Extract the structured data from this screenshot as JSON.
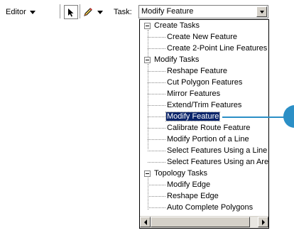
{
  "toolbar": {
    "editor_label": "Editor",
    "task_label": "Task:",
    "task_value": "Modify Feature"
  },
  "tree": [
    {
      "label": "Create Tasks",
      "group": true
    },
    {
      "label": "Create New Feature"
    },
    {
      "label": "Create 2-Point Line Features"
    },
    {
      "label": "Modify Tasks",
      "group": true
    },
    {
      "label": "Reshape Feature"
    },
    {
      "label": "Cut Polygon Features"
    },
    {
      "label": "Mirror Features"
    },
    {
      "label": "Extend/Trim Features"
    },
    {
      "label": "Modify Feature",
      "selected": true
    },
    {
      "label": "Calibrate Route Feature"
    },
    {
      "label": "Modify Portion of a Line"
    },
    {
      "label": "Select Features Using a Line"
    },
    {
      "label": "Select Features Using an Area"
    },
    {
      "label": "Topology Tasks",
      "group": true
    },
    {
      "label": "Modify Edge"
    },
    {
      "label": "Reshape Edge"
    },
    {
      "label": "Auto Complete Polygons"
    }
  ],
  "colors": {
    "selection_bg": "#0a246a",
    "callout": "#2b8fc6"
  }
}
